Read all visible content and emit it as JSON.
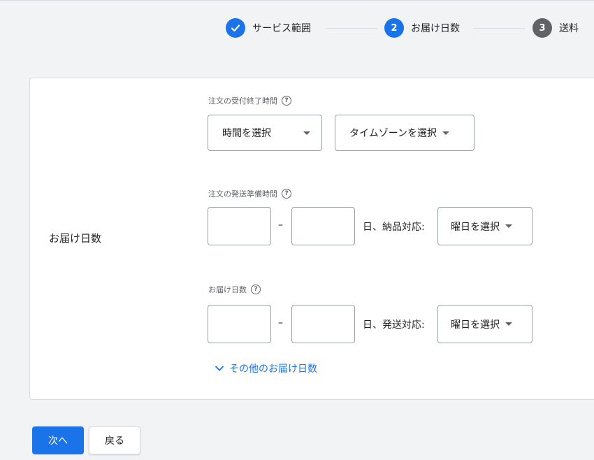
{
  "stepper": {
    "steps": [
      {
        "number": "",
        "label": "サービス範囲",
        "state": "done"
      },
      {
        "number": "2",
        "label": "お届け日数",
        "state": "current"
      },
      {
        "number": "3",
        "label": "送料",
        "state": "future"
      }
    ]
  },
  "form": {
    "row_label": "お届け日数",
    "cutoff": {
      "label": "注文の受付終了時間",
      "time_select": "時間を選択",
      "timezone_select": "タイムゾーンを選択"
    },
    "handling": {
      "label": "注文の発送準備時間",
      "min_value": "",
      "max_value": "",
      "dash": "–",
      "suffix": "日、納品対応:",
      "days_select": "曜日を選択"
    },
    "transit": {
      "label": "お届け日数",
      "min_value": "",
      "max_value": "",
      "dash": "–",
      "suffix": "日、発送対応:",
      "days_select": "曜日を選択"
    },
    "more_link": "その他のお届け日数"
  },
  "buttons": {
    "next": "次へ",
    "back": "戻る"
  },
  "colors": {
    "accent": "#1a73e8",
    "inactive_step": "#5f6368",
    "background": "#f1f3f4"
  }
}
